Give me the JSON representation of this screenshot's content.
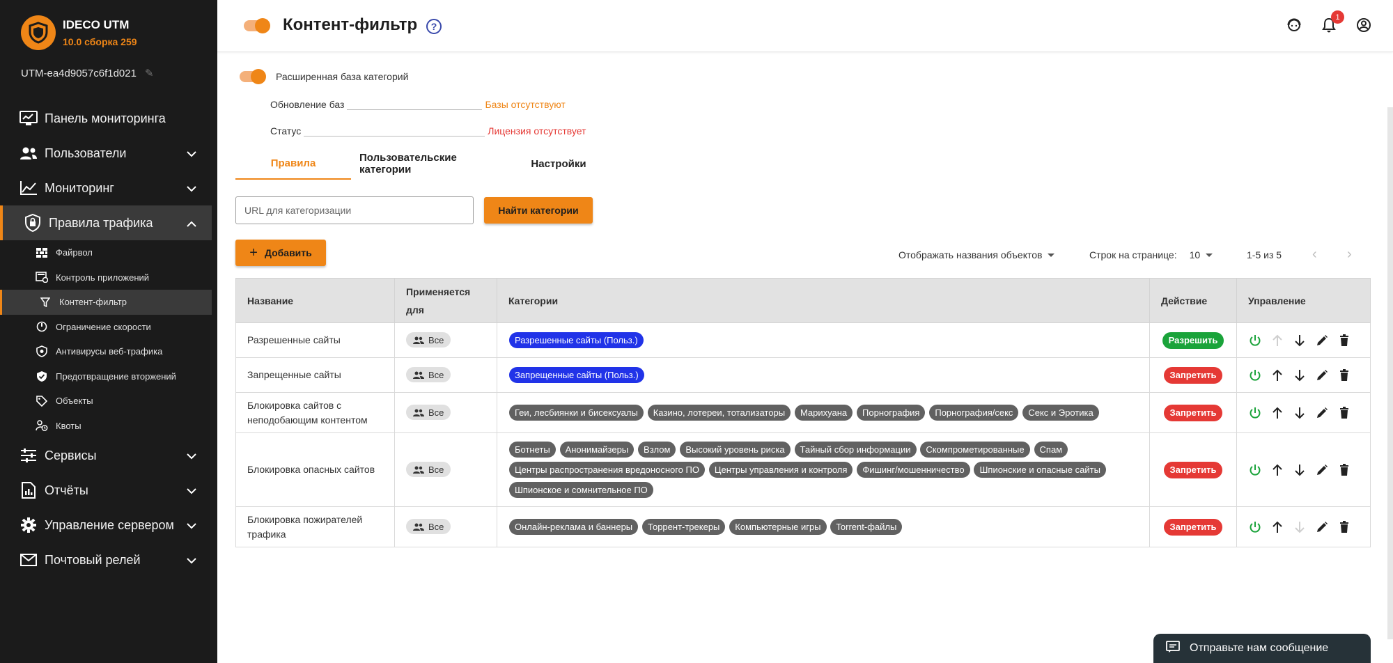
{
  "brand": {
    "name": "IDECO UTM",
    "version": "10.0 сборка 259"
  },
  "device": {
    "name": "UTM-ea4d9057c6f1d021"
  },
  "sidebar": {
    "items": [
      {
        "label": "Панель мониторинга"
      },
      {
        "label": "Пользователи"
      },
      {
        "label": "Мониторинг"
      },
      {
        "label": "Правила трафика"
      },
      {
        "label": "Сервисы"
      },
      {
        "label": "Отчёты"
      },
      {
        "label": "Управление сервером"
      },
      {
        "label": "Почтовый релей"
      }
    ],
    "sub": [
      {
        "label": "Файрвол"
      },
      {
        "label": "Контроль приложений"
      },
      {
        "label": "Контент-фильтр"
      },
      {
        "label": "Ограничение скорости"
      },
      {
        "label": "Антивирусы веб-трафика"
      },
      {
        "label": "Предотвращение вторжений"
      },
      {
        "label": "Объекты"
      },
      {
        "label": "Квоты"
      }
    ]
  },
  "header": {
    "title": "Контент-фильтр",
    "notifications": "1"
  },
  "main": {
    "ext_label": "Расширенная база категорий",
    "update_label": "Обновление баз",
    "update_value": "Базы отсутствуют",
    "status_label": "Статус",
    "status_value": "Лицензия отсутствует",
    "tabs": [
      {
        "label": "Правила"
      },
      {
        "label": "Пользовательские категории"
      },
      {
        "label": "Настройки"
      }
    ],
    "url_placeholder": "URL для категоризации",
    "find_button": "Найти категории",
    "add_button": "Добавить",
    "display_names": "Отображать названия объектов",
    "rows_per_page_label": "Строк на странице:",
    "rows_per_page": "10",
    "range": "1-5 из 5"
  },
  "table": {
    "headers": [
      "Название",
      "Применяется для",
      "Категории",
      "Действие",
      "Управление"
    ],
    "rows": [
      {
        "name": "Разрешенные сайты",
        "applies": "Все",
        "categories": [
          "Разрешенные сайты (Польз.)"
        ],
        "action": "Разрешить"
      },
      {
        "name": "Запрещенные сайты",
        "applies": "Все",
        "categories": [
          "Запрещенные сайты (Польз.)"
        ],
        "action": "Запретить"
      },
      {
        "name": "Блокировка сайтов с неподобающим контентом",
        "applies": "Все",
        "categories": [
          "Геи, лесбиянки и бисексуалы",
          "Казино, лотереи, тотализаторы",
          "Марихуана",
          "Порнография",
          "Порнография/секс",
          "Секс и Эротика"
        ],
        "action": "Запретить"
      },
      {
        "name": "Блокировка опасных сайтов",
        "applies": "Все",
        "categories": [
          "Ботнеты",
          "Анонимайзеры",
          "Взлом",
          "Высокий уровень риска",
          "Тайный сбор информации",
          "Скомпрометированные",
          "Спам",
          "Центры распространения вредоносного ПО",
          "Центры управления и контроля",
          "Фишинг/мошенничество",
          "Шпионские и опасные сайты",
          "Шпионское и сомнительное ПО"
        ],
        "action": "Запретить"
      },
      {
        "name": "Блокировка пожирателей трафика",
        "applies": "Все",
        "categories": [
          "Онлайн-реклама и баннеры",
          "Торрент-трекеры",
          "Компьютерные игры",
          "Torrent-файлы"
        ],
        "action": "Запретить"
      }
    ]
  },
  "widget": {
    "message": "Отправьте нам сообщение"
  },
  "colors": {
    "accent": "#ef8617",
    "sidebar_bg": "#1b1b1b",
    "allow": "#1aa33a",
    "deny": "#e53935",
    "user_category": "#2133e8",
    "category": "#616161"
  }
}
